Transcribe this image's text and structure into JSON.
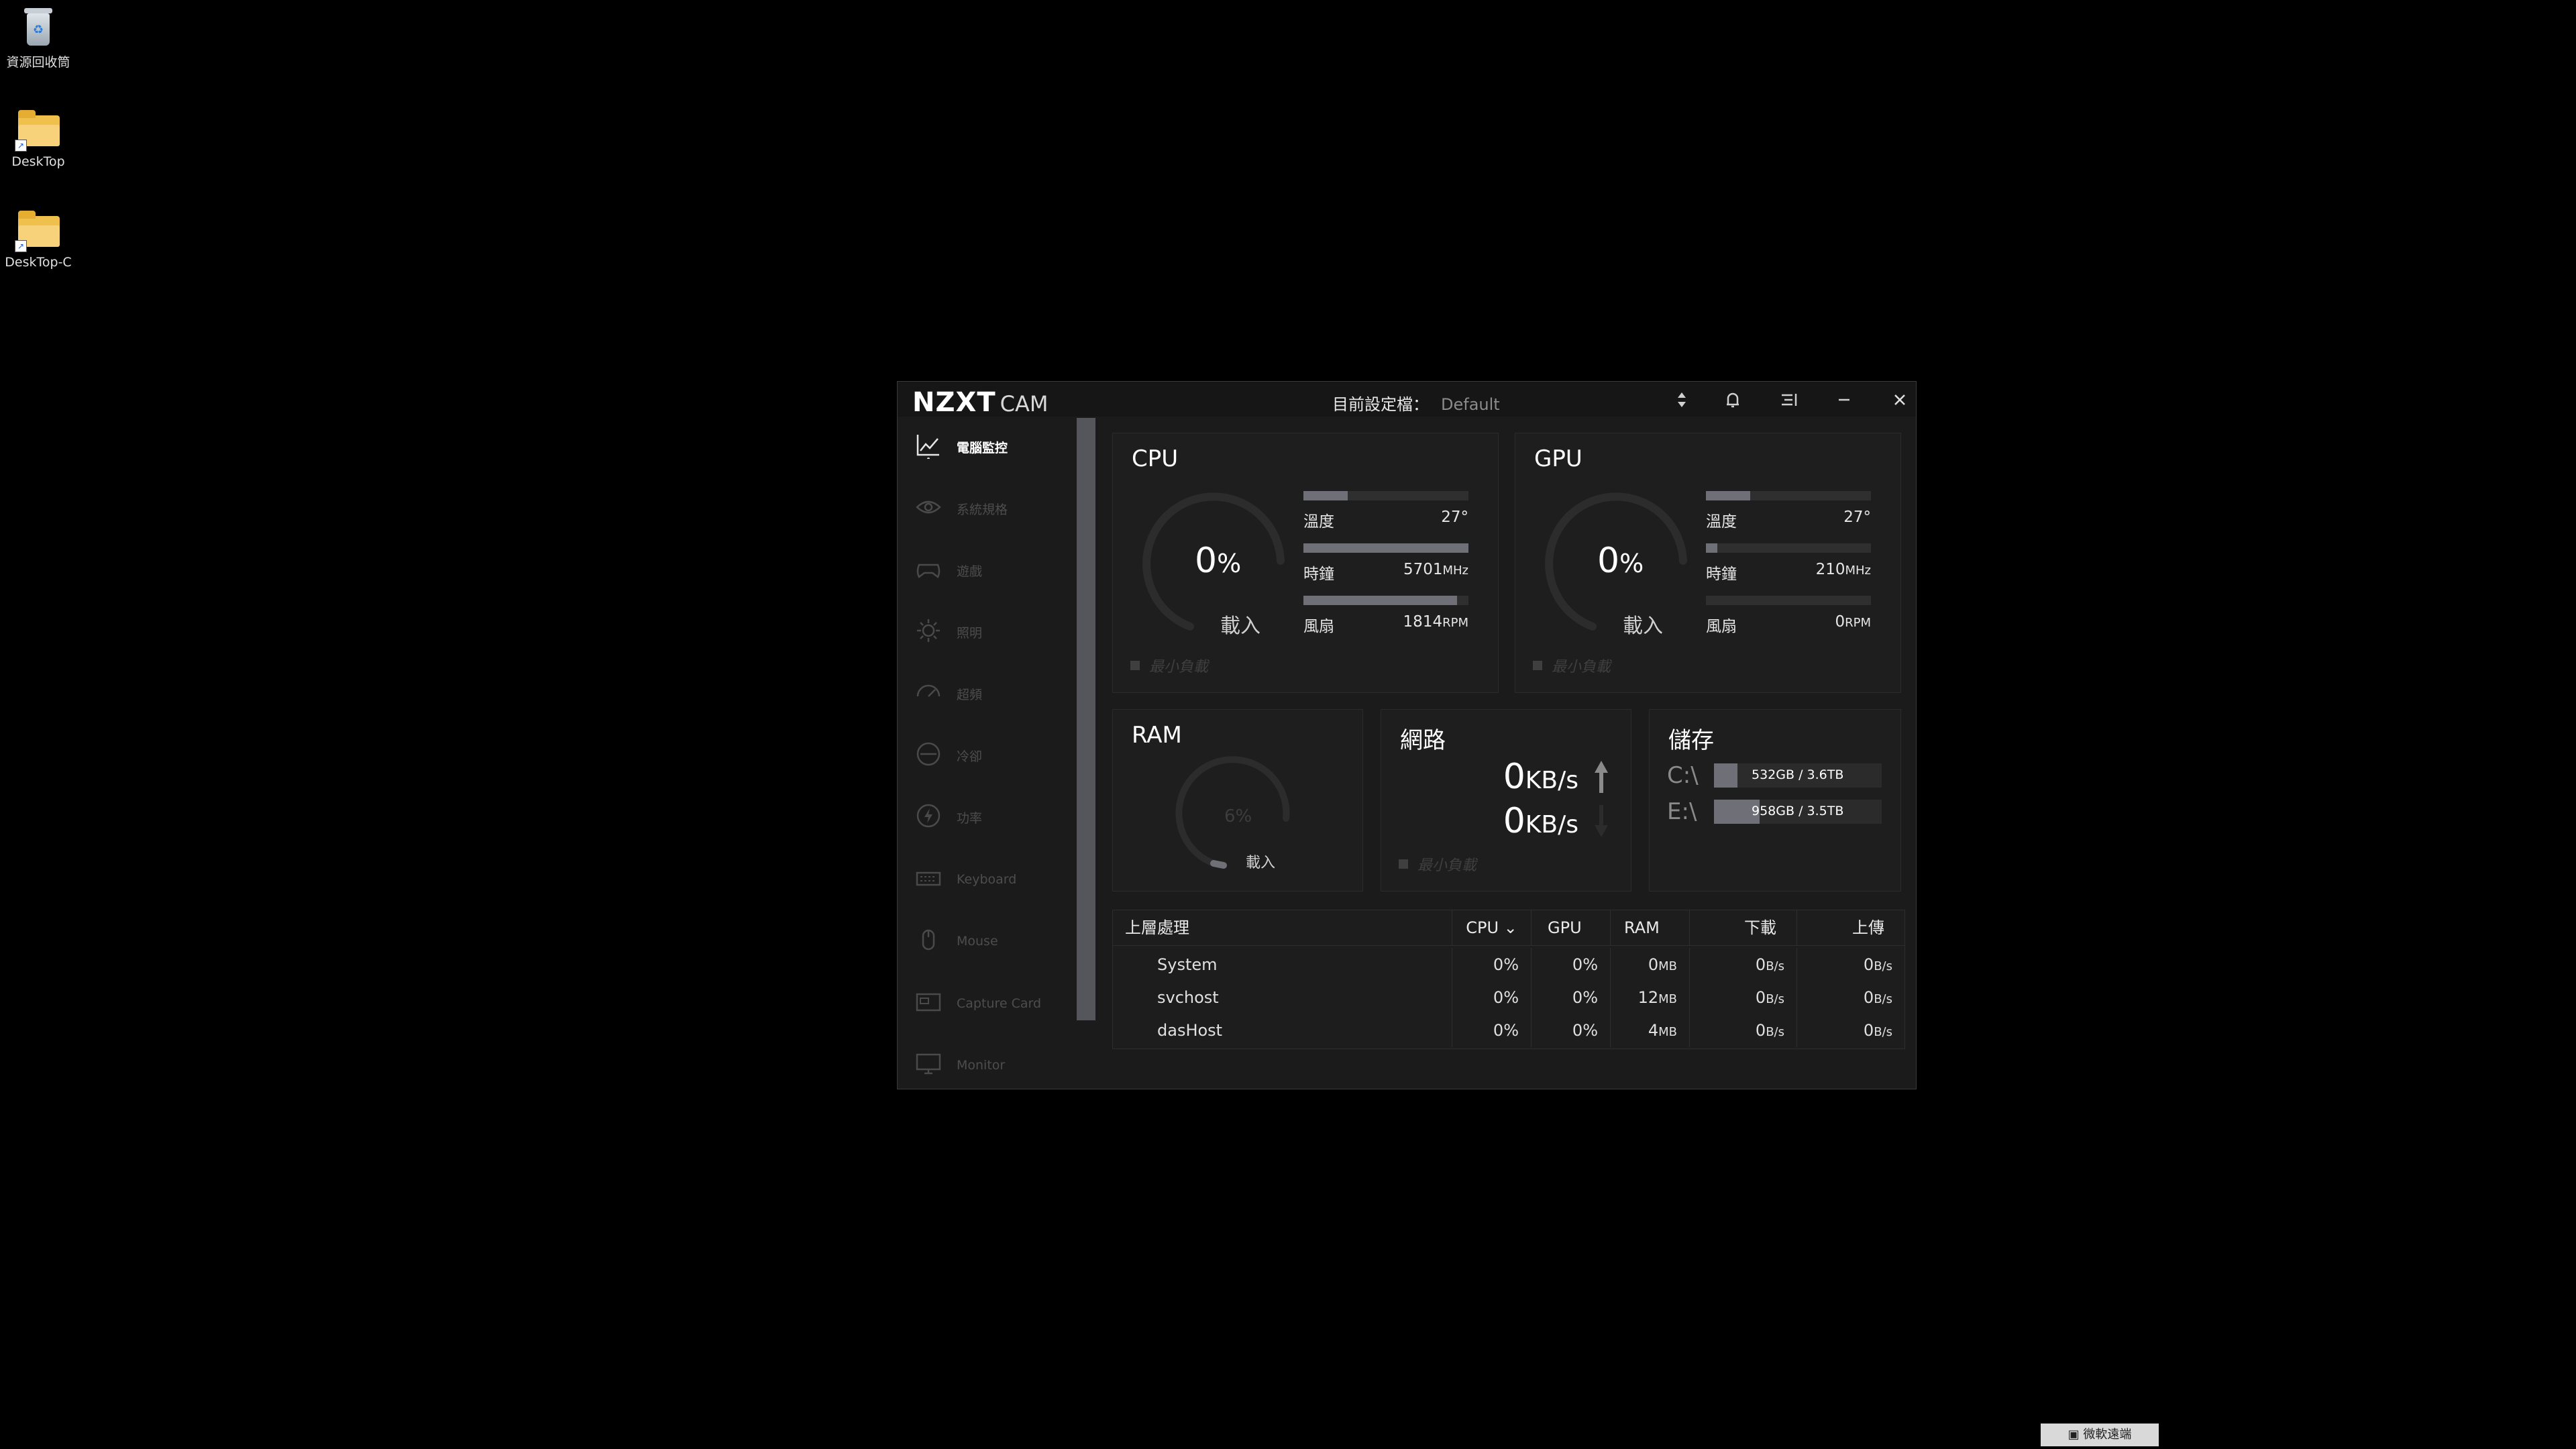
{
  "desktop": {
    "icons": [
      {
        "label": "資源回收筒",
        "icon": "recycle-bin-icon"
      },
      {
        "label": "DeskTop",
        "icon": "folder-shortcut-icon"
      },
      {
        "label": "DeskTop-C",
        "icon": "folder-shortcut-icon"
      }
    ]
  },
  "app": {
    "logo_main": "NZXT",
    "logo_sub": "CAM",
    "profile_label": "目前設定檔：",
    "profile_value": "Default"
  },
  "sidebar": {
    "items": [
      {
        "label": "電腦監控",
        "icon": "chart-line-icon",
        "active": true
      },
      {
        "label": "系統規格",
        "icon": "eye-icon"
      },
      {
        "label": "遊戲",
        "icon": "gamepad-icon"
      },
      {
        "label": "照明",
        "icon": "sun-icon"
      },
      {
        "label": "超頻",
        "icon": "speedometer-icon"
      },
      {
        "label": "冷卻",
        "icon": "fan-icon"
      },
      {
        "label": "功率",
        "icon": "power-bolt-icon"
      },
      {
        "label": "Keyboard",
        "icon": "keyboard-icon"
      },
      {
        "label": "Mouse",
        "icon": "mouse-icon"
      },
      {
        "label": "Capture Card",
        "icon": "capture-card-icon"
      },
      {
        "label": "Monitor",
        "icon": "monitor-icon"
      }
    ]
  },
  "cpu": {
    "title": "CPU",
    "load_value": "0",
    "load_unit": "%",
    "load_label": "載入",
    "temp_label": "溫度",
    "temp_value": "27°",
    "temp_fill": 0.27,
    "clock_label": "時鐘",
    "clock_value": "5701",
    "clock_unit": "MHz",
    "clock_fill": 1.0,
    "fan_label": "風扇",
    "fan_value": "1814",
    "fan_unit": "RPM",
    "fan_fill": 0.93,
    "min_load": "最小負載"
  },
  "gpu": {
    "title": "GPU",
    "load_value": "0",
    "load_unit": "%",
    "load_label": "載入",
    "temp_label": "溫度",
    "temp_value": "27°",
    "temp_fill": 0.27,
    "clock_label": "時鐘",
    "clock_value": "210",
    "clock_unit": "MHz",
    "clock_fill": 0.07,
    "fan_label": "風扇",
    "fan_value": "0",
    "fan_unit": "RPM",
    "fan_fill": 0.0,
    "min_load": "最小負載"
  },
  "ram": {
    "title": "RAM",
    "load_value": "6%",
    "load_label": "載入"
  },
  "network": {
    "title": "網路",
    "up_value": "0",
    "up_unit": "KB/s",
    "down_value": "0",
    "down_unit": "KB/s",
    "min_load": "最小負載"
  },
  "storage": {
    "title": "儲存",
    "drives": [
      {
        "letter": "C:\\",
        "text": "532GB / 3.6TB",
        "fill": 0.14
      },
      {
        "letter": "E:\\",
        "text": "958GB / 3.5TB",
        "fill": 0.27
      }
    ]
  },
  "processes": {
    "headers": {
      "name": "上層處理",
      "cpu": "CPU",
      "gpu": "GPU",
      "ram": "RAM",
      "down": "下載",
      "up": "上傳"
    },
    "rows": [
      {
        "name": "System",
        "cpu": "0%",
        "gpu": "0%",
        "ram": "0",
        "ram_unit": "MB",
        "down": "0",
        "down_unit": "B/s",
        "up": "0",
        "up_unit": "B/s"
      },
      {
        "name": "svchost",
        "cpu": "0%",
        "gpu": "0%",
        "ram": "12",
        "ram_unit": "MB",
        "down": "0",
        "down_unit": "B/s",
        "up": "0",
        "up_unit": "B/s"
      },
      {
        "name": "dasHost",
        "cpu": "0%",
        "gpu": "0%",
        "ram": "4",
        "ram_unit": "MB",
        "down": "0",
        "down_unit": "B/s",
        "up": "0",
        "up_unit": "B/s"
      }
    ]
  },
  "taskbar": {
    "button_label": "微軟遠端"
  },
  "colors": {
    "bar_fill": "#6f6f78",
    "bar_track": "#2f2f2f",
    "gauge_track": "#2c2c2c"
  }
}
